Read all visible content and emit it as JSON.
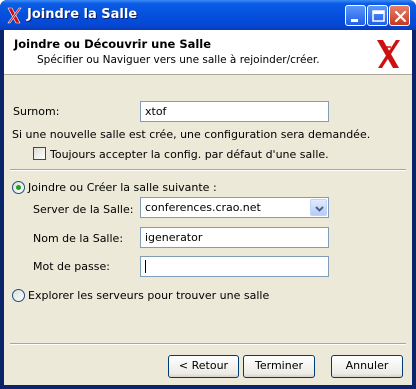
{
  "window": {
    "title": "Joindre la Salle"
  },
  "header": {
    "title": "Joindre ou Découvrir une Salle",
    "subtitle": "Spécifier ou Naviguer vers une salle à rejoinder/créer."
  },
  "form": {
    "nickname_label": "Surnom:",
    "nickname_value": "xtof",
    "info_text": "Si une nouvelle salle est crée, une configuration sera demandée.",
    "default_config_label": "Toujours accepter la config. par défaut d'une salle.",
    "default_config_checked": false,
    "join_option_label": "Joindre ou Créer la salle suivante :",
    "join_option_selected": true,
    "server_label": "Server de la Salle:",
    "server_value": "conferences.crao.net",
    "room_label": "Nom de la Salle:",
    "room_value": "igenerator",
    "password_label": "Mot de passe:",
    "password_value": "",
    "browse_option_label": "Explorer les serveurs pour trouver une salle",
    "browse_option_selected": false
  },
  "buttons": {
    "back": "< Retour",
    "finish": "Terminer",
    "cancel": "Annuler"
  },
  "colors": {
    "titlebar": "#0550dc",
    "dialog_bg": "#ece9d8",
    "logo_red": "#cc1111",
    "radio_dot": "#21a121"
  }
}
